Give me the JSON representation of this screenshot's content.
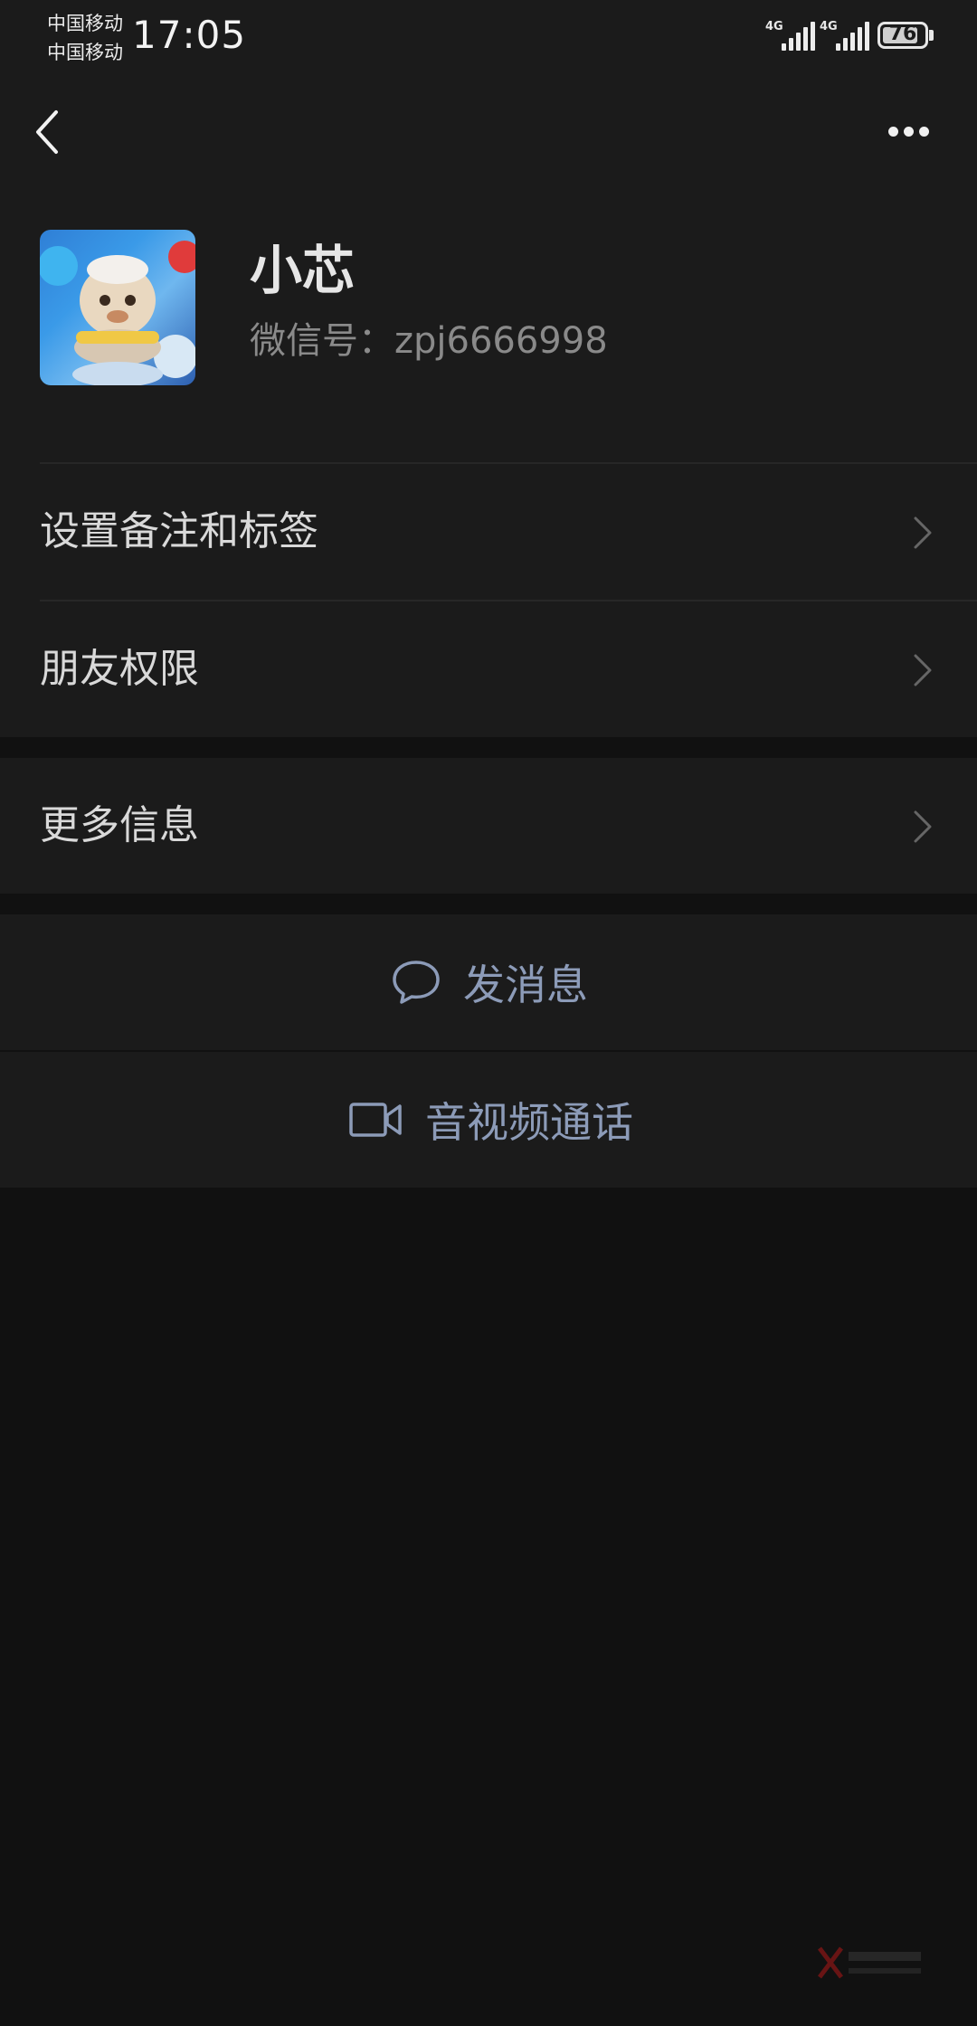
{
  "status_bar": {
    "carrier_1": "中国移动",
    "carrier_2": "中国移动",
    "time": "17:05",
    "network_1": "4G",
    "network_2": "4G",
    "battery": "76"
  },
  "nav": {
    "back_icon": "chevron-left-icon",
    "more_icon": "more-dots-icon"
  },
  "profile": {
    "name": "小芯",
    "wechat_id": "微信号：zpj6666998"
  },
  "menu": {
    "items": [
      {
        "label": "设置备注和标签"
      },
      {
        "label": "朋友权限"
      },
      {
        "label": "更多信息"
      }
    ]
  },
  "actions": {
    "message": {
      "label": "发消息",
      "icon": "chat-bubble-icon"
    },
    "call": {
      "label": "音视频通话",
      "icon": "video-camera-icon"
    }
  },
  "colors": {
    "background": "#111111",
    "surface": "#1b1b1b",
    "action_text": "#8c9bb8"
  }
}
